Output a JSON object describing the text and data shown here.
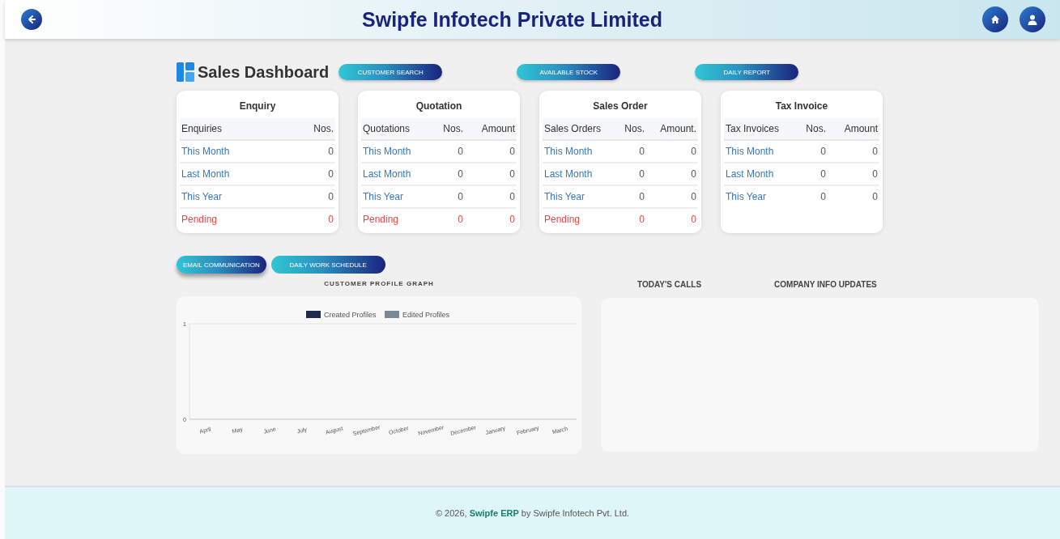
{
  "header": {
    "title": "Swipfe Infotech Private Limited"
  },
  "dashboard": {
    "title": "Sales Dashboard",
    "actions": [
      "CUSTOMER SEARCH",
      "AVAILABLE STOCK",
      "DAILY REPORT"
    ]
  },
  "cards": [
    {
      "title": "Enquiry",
      "columns": [
        "Enquiries",
        "Nos."
      ],
      "rows": [
        {
          "kind": "normal",
          "cells": [
            "This Month",
            "0"
          ]
        },
        {
          "kind": "normal",
          "cells": [
            "Last Month",
            "0"
          ]
        },
        {
          "kind": "normal",
          "cells": [
            "This Year",
            "0"
          ]
        },
        {
          "kind": "pending",
          "cells": [
            "Pending",
            "0"
          ]
        }
      ]
    },
    {
      "title": "Quotation",
      "columns": [
        "Quotations",
        "Nos.",
        "Amount"
      ],
      "rows": [
        {
          "kind": "normal",
          "cells": [
            "This Month",
            "0",
            "0"
          ]
        },
        {
          "kind": "normal",
          "cells": [
            "Last Month",
            "0",
            "0"
          ]
        },
        {
          "kind": "normal",
          "cells": [
            "This Year",
            "0",
            "0"
          ]
        },
        {
          "kind": "pending",
          "cells": [
            "Pending",
            "0",
            "0"
          ]
        }
      ]
    },
    {
      "title": "Sales Order",
      "columns": [
        "Sales Orders",
        "Nos.",
        "Amount."
      ],
      "rows": [
        {
          "kind": "normal",
          "cells": [
            "This Month",
            "0",
            "0"
          ]
        },
        {
          "kind": "normal",
          "cells": [
            "Last Month",
            "0",
            "0"
          ]
        },
        {
          "kind": "normal",
          "cells": [
            "This Year",
            "0",
            "0"
          ]
        },
        {
          "kind": "pending",
          "cells": [
            "Pending",
            "0",
            "0"
          ]
        }
      ]
    },
    {
      "title": "Tax Invoice",
      "columns": [
        "Tax Invoices",
        "Nos.",
        "Amount"
      ],
      "rows": [
        {
          "kind": "normal",
          "cells": [
            "This Month",
            "0",
            "0"
          ]
        },
        {
          "kind": "normal",
          "cells": [
            "Last Month",
            "0",
            "0"
          ]
        },
        {
          "kind": "normal",
          "cells": [
            "This Year",
            "0",
            "0"
          ]
        }
      ]
    }
  ],
  "tabs": [
    {
      "label": "EMAIL COMMUNICATION",
      "selected": true
    },
    {
      "label": "DAILY WORK SCHEDULE",
      "selected": false
    }
  ],
  "graph": {
    "title": "CUSTOMER PROFILE GRAPH",
    "chart_data": {
      "type": "bar",
      "categories": [
        "April",
        "May",
        "June",
        "July",
        "August",
        "September",
        "October",
        "November",
        "December",
        "January",
        "February",
        "March"
      ],
      "series": [
        {
          "name": "Created Profiles",
          "color": "#1b2a4e",
          "values": [
            0,
            0,
            0,
            0,
            0,
            0,
            0,
            0,
            0,
            0,
            0,
            0
          ]
        },
        {
          "name": "Edited Profiles",
          "color": "#7a8794",
          "values": [
            0,
            0,
            0,
            0,
            0,
            0,
            0,
            0,
            0,
            0,
            0,
            0
          ]
        }
      ],
      "ylim": [
        0,
        1
      ],
      "yticks": [
        0,
        1
      ]
    }
  },
  "side_headings": [
    "TODAY'S CALLS",
    "COMPANY INFO UPDATES"
  ],
  "footer": {
    "text": "© 2026, **Swipfe ERP** by Swipfe Infotech Pvt. Ltd."
  }
}
